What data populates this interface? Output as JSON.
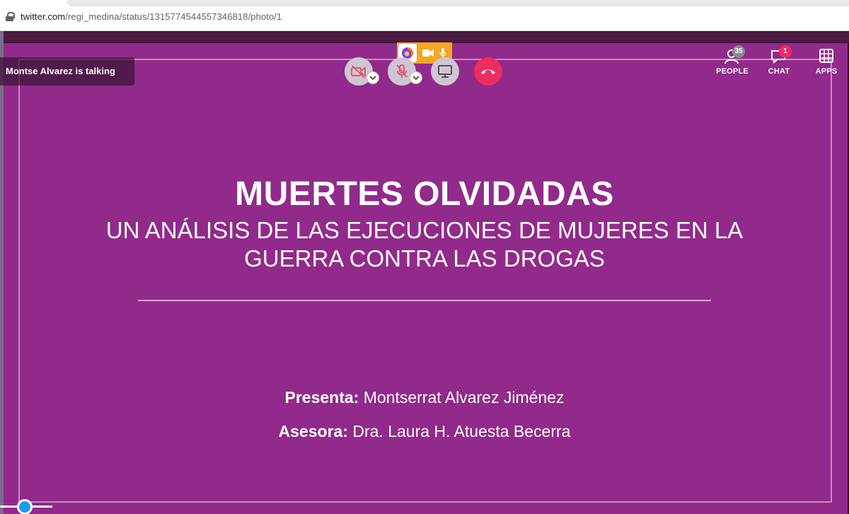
{
  "browser": {
    "url_host": "twitter.com",
    "url_path": "/regi_medina/status/1315774544557346818/photo/1"
  },
  "meeting": {
    "talking_indicator": "Montse Alvarez is talking",
    "controls": {
      "video_icon": "camera-off-icon",
      "mic_icon": "mic-off-icon",
      "screen_icon": "screen-share-icon",
      "hangup_icon": "hangup-icon"
    },
    "right_toolbar": {
      "people": {
        "label": "PEOPLE",
        "count": "35"
      },
      "chat": {
        "label": "CHAT",
        "count": "1"
      },
      "apps": {
        "label": "APPS"
      }
    }
  },
  "slide": {
    "title": "MUERTES OLVIDADAS",
    "subtitle_line1": "UN ANÁLISIS DE LAS EJECUCIONES DE MUJERES EN LA",
    "subtitle_line2": "GUERRA CONTRA LAS DROGAS",
    "presenter_label": "Presenta:",
    "presenter_name": "Montserrat Alvarez Jiménez",
    "advisor_label": "Asesora:",
    "advisor_name": "Dra. Laura H. Atuesta Becerra"
  },
  "colors": {
    "slide_bg": "#912a8a",
    "hangup": "#ec2d60",
    "share_pill": "#f5a623",
    "slider_knob": "#1a9bf0"
  }
}
